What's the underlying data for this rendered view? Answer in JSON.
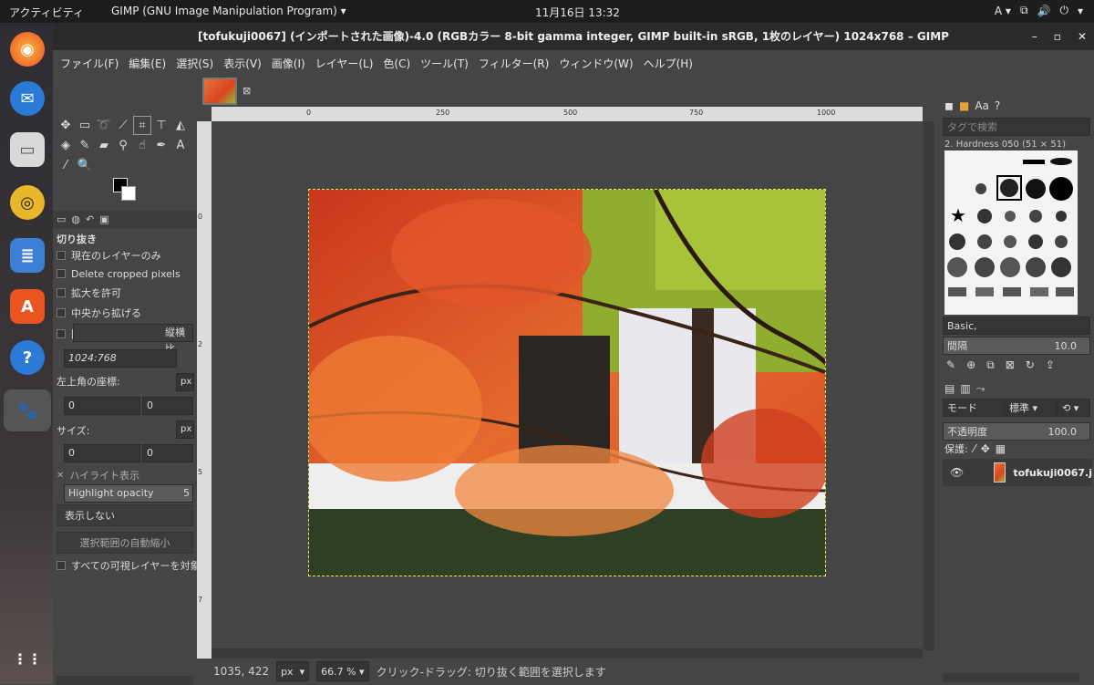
{
  "topbar": {
    "activities": "アクティビティ",
    "app": "GIMP (GNU Image Manipulation Program) ▾",
    "clock": "11月16日  13:32",
    "input": "A ▾"
  },
  "titlebar": {
    "title": "[tofukuji0067] (インポートされた画像)-4.0 (RGBカラー 8-bit gamma integer, GIMP built-in sRGB, 1枚のレイヤー) 1024x768 – GIMP"
  },
  "menu": [
    "ファイル(F)",
    "編集(E)",
    "選択(S)",
    "表示(V)",
    "画像(I)",
    "レイヤー(L)",
    "色(C)",
    "ツール(T)",
    "フィルター(R)",
    "ウィンドウ(W)",
    "ヘルプ(H)"
  ],
  "tool_options": {
    "title": "切り抜き",
    "current_layer_only": "現在のレイヤーのみ",
    "delete_cropped": "Delete cropped pixels",
    "allow_growing": "拡大を許可",
    "expand_center": "中央から拡げる",
    "fixed": "固定",
    "aspect": "縦横比",
    "ratio_value": "1024:768",
    "position_label": "左上角の座標:",
    "unit": "px",
    "pos_x": "0",
    "pos_y": "0",
    "size_label": "サイズ:",
    "size_w": "0",
    "size_h": "0",
    "highlight": "ハイライト表示",
    "highlight_opacity": "Highlight opacity",
    "opacity_value": "5",
    "guide": "表示しない",
    "autoshrink": "選択範囲の自動縮小",
    "all_layers": "すべての可視レイヤーを対象に"
  },
  "ruler": {
    "ticks": [
      "0",
      "250",
      "500",
      "750",
      "1000"
    ],
    "vticks": [
      "0",
      "2",
      "5",
      "7"
    ]
  },
  "status": {
    "coords": "1035, 422",
    "unit": "px",
    "zoom": "66.7 %",
    "message": "クリック-ドラッグ: 切り抜く範囲を選択します"
  },
  "brushes": {
    "tag_placeholder": "タグで検索",
    "brush_name": "2. Hardness 050 (51 × 51)",
    "preset": "Basic,",
    "spacing_label": "間隔",
    "spacing_value": "10.0"
  },
  "layers": {
    "mode_label": "モード",
    "mode_value": "標準",
    "opacity_label": "不透明度",
    "opacity_value": "100.0",
    "lock_label": "保護:",
    "layer_name": "tofukuji0067.j"
  }
}
